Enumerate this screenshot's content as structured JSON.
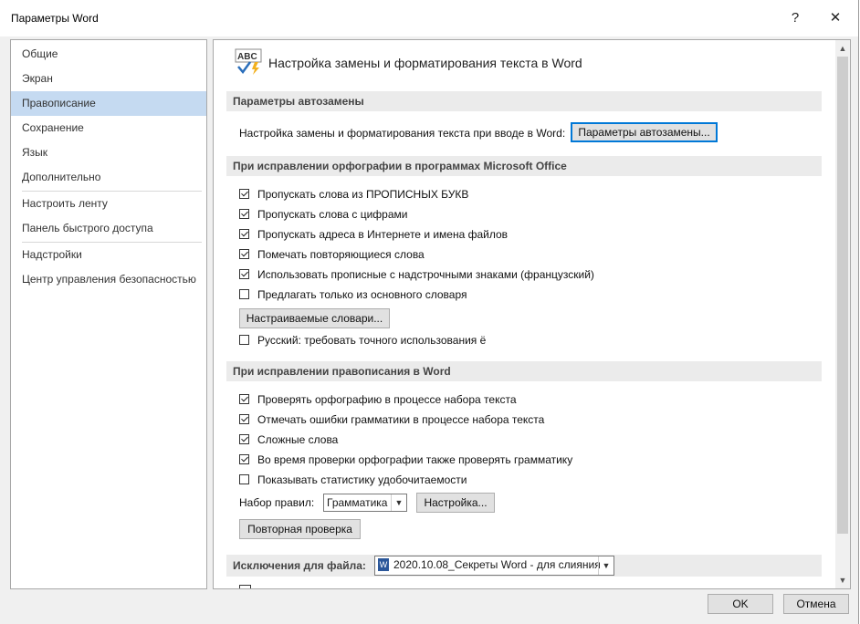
{
  "window": {
    "title": "Параметры Word",
    "help_glyph": "?",
    "close_glyph": "✕"
  },
  "nav": {
    "items": [
      {
        "label": "Общие"
      },
      {
        "label": "Экран"
      },
      {
        "label": "Правописание"
      },
      {
        "label": "Сохранение"
      },
      {
        "label": "Язык"
      },
      {
        "label": "Дополнительно"
      },
      {
        "label": "Настроить ленту"
      },
      {
        "label": "Панель быстрого доступа"
      },
      {
        "label": "Надстройки"
      },
      {
        "label": "Центр управления безопасностью"
      }
    ],
    "selected": "Правописание"
  },
  "content": {
    "heading": "Настройка замены и форматирования текста в Word",
    "heading_icon": "abc-check-icon",
    "autocorrect": {
      "section": "Параметры автозамены",
      "label": "Настройка замены и форматирования текста при вводе в Word:",
      "button": "Параметры автозамены..."
    },
    "office_spelling": {
      "section": "При исправлении орфографии в программах Microsoft Office",
      "options": [
        {
          "label": "Пропускать слова из ПРОПИСНЫХ БУКВ",
          "checked": true
        },
        {
          "label": "Пропускать слова с цифрами",
          "checked": true
        },
        {
          "label": "Пропускать адреса в Интернете и имена файлов",
          "checked": true
        },
        {
          "label": "Помечать повторяющиеся слова",
          "checked": true
        },
        {
          "label": "Использовать прописные с надстрочными знаками (французский)",
          "checked": true
        },
        {
          "label": "Предлагать только из основного словаря",
          "checked": false
        }
      ],
      "dictionaries_button": "Настраиваемые словари...",
      "russian_option": {
        "label": "Русский: требовать точного использования ё",
        "checked": false
      }
    },
    "word_spelling": {
      "section": "При исправлении правописания в Word",
      "options": [
        {
          "label": "Проверять орфографию в процессе набора текста",
          "checked": true
        },
        {
          "label": "Отмечать ошибки грамматики в процессе набора текста",
          "checked": true
        },
        {
          "label": "Сложные слова",
          "checked": true
        },
        {
          "label": "Во время проверки орфографии также проверять грамматику",
          "checked": true
        },
        {
          "label": "Показывать статистику удобочитаемости",
          "checked": false
        }
      ],
      "ruleset_label": "Набор правил:",
      "ruleset_value": "Грамматика",
      "settings_button": "Настройка...",
      "recheck_button": "Повторная проверка"
    },
    "exceptions": {
      "section": "Исключения для файла:",
      "file": "2020.10.08_Секреты Word - для слияния"
    }
  },
  "footer": {
    "ok": "OK",
    "cancel": "Отмена"
  },
  "colors": {
    "selected_nav": "#c5daf1",
    "accent": "#0078d7",
    "section_bg": "#ebebeb"
  }
}
